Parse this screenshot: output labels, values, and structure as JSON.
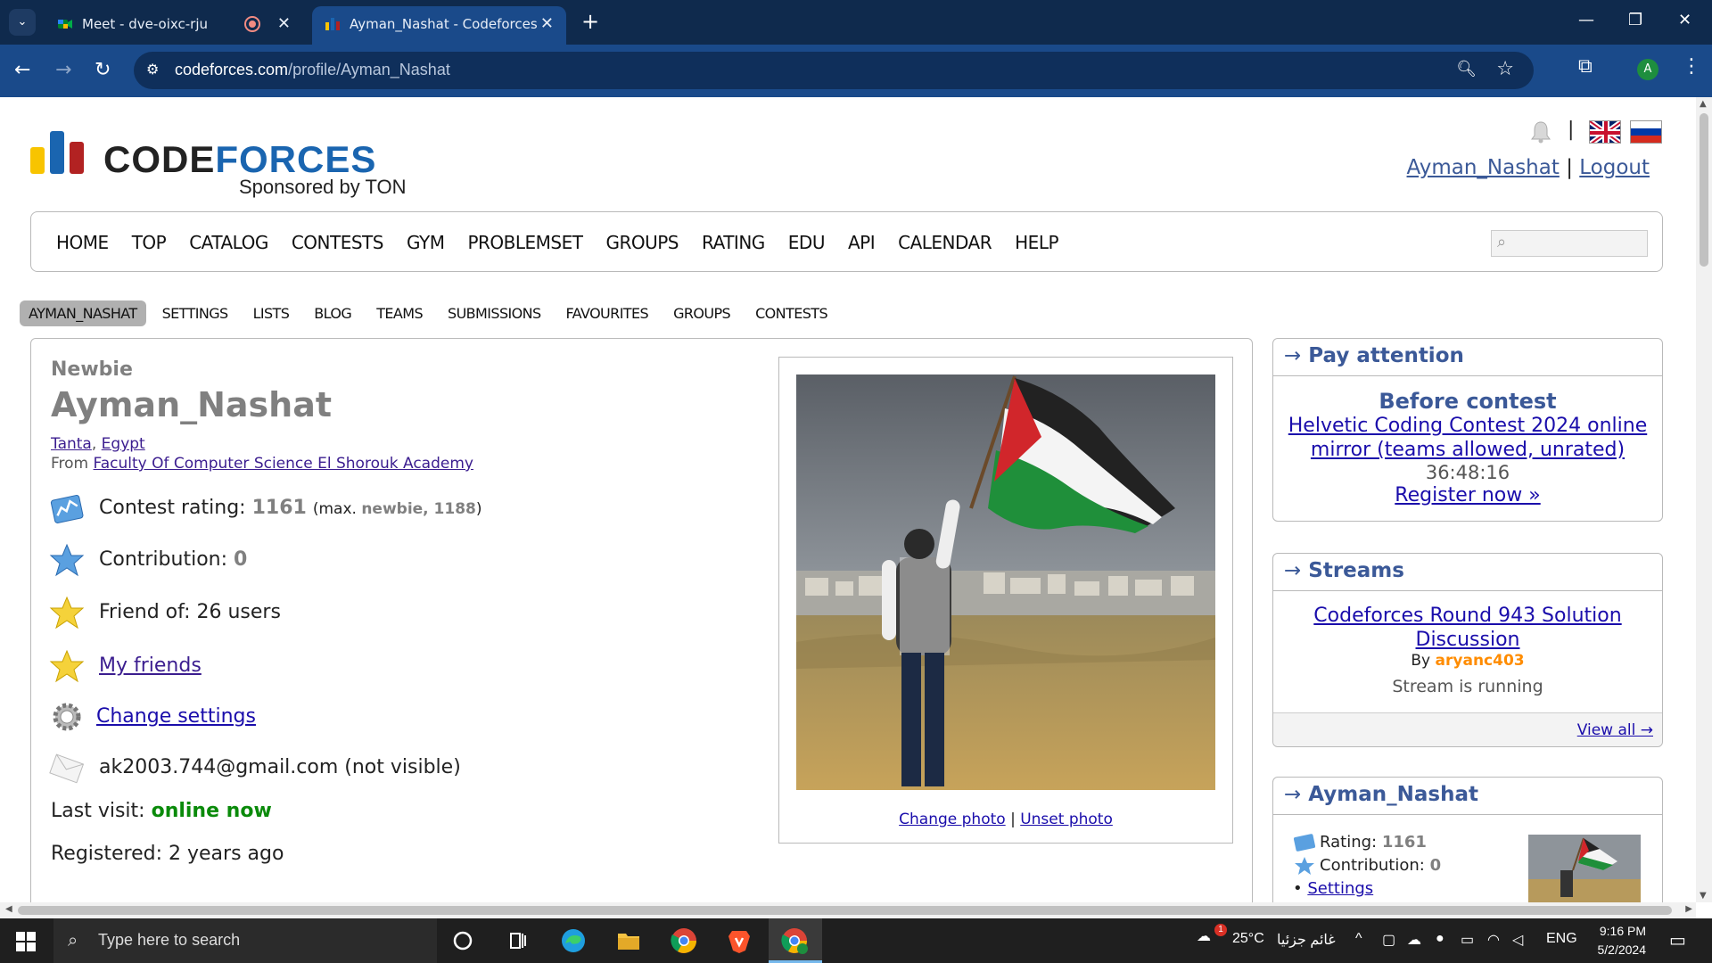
{
  "browser": {
    "tabs": [
      {
        "title": "Meet - dve-oixc-rju",
        "recording": true
      },
      {
        "title": "Ayman_Nashat - Codeforces",
        "active": true
      }
    ],
    "url_domain": "codeforces.com",
    "url_path": "/profile/Ayman_Nashat",
    "profile_initial": "A"
  },
  "site": {
    "logo_a": "CODE",
    "logo_b": "FORCES",
    "sponsor": "Sponsored by TON",
    "user_link": "Ayman_Nashat",
    "logout_link": "Logout",
    "separator": "|",
    "main_menu": [
      "HOME",
      "TOP",
      "CATALOG",
      "CONTESTS",
      "GYM",
      "PROBLEMSET",
      "GROUPS",
      "RATING",
      "EDU",
      "API",
      "CALENDAR",
      "HELP"
    ],
    "second_menu": [
      "AYMAN_NASHAT",
      "SETTINGS",
      "LISTS",
      "BLOG",
      "TEAMS",
      "SUBMISSIONS",
      "FAVOURITES",
      "GROUPS",
      "CONTESTS"
    ]
  },
  "profile": {
    "rank": "Newbie",
    "handle": "Ayman_Nashat",
    "city": "Tanta",
    "country": "Egypt",
    "from_label": "From",
    "organization": "Faculty Of Computer Science El Shorouk Academy",
    "rating_label": "Contest rating:",
    "rating": "1161",
    "rating_max_prefix": "(max.",
    "rating_max_rank": "newbie, 1188",
    "rating_max_suffix": ")",
    "contribution_label": "Contribution:",
    "contribution": "0",
    "friend_of": "Friend of: 26 users",
    "my_friends": "My friends",
    "change_settings": "Change settings",
    "email": "ak2003.744@gmail.com (not visible)",
    "last_visit_label": "Last visit:",
    "last_visit": "online now",
    "registered": "Registered: 2 years ago",
    "change_photo": "Change photo",
    "unset_photo": "Unset photo"
  },
  "sidebar": {
    "pay_attention": {
      "header": "Pay attention",
      "title": "Before contest",
      "contest": "Helvetic Coding Contest 2024 online mirror (teams allowed, unrated)",
      "timer": "36:48:16",
      "register": "Register now »"
    },
    "streams": {
      "header": "Streams",
      "title": "Codeforces Round 943 Solution Discussion",
      "by_label": "By",
      "author": "aryanc403",
      "status": "Stream is running",
      "view_all": "View all →"
    },
    "user_box": {
      "header": "Ayman_Nashat",
      "rating_label": "Rating:",
      "rating": "1161",
      "contribution_label": "Contribution:",
      "contribution": "0",
      "settings": "Settings"
    },
    "arrow": "→"
  },
  "taskbar": {
    "search_placeholder": "Type here to search",
    "temperature": "25°C",
    "weather": "غائم جزئيا",
    "lang": "ENG",
    "time": "9:16 PM",
    "date": "5/2/2024",
    "weather_badge": "1"
  }
}
